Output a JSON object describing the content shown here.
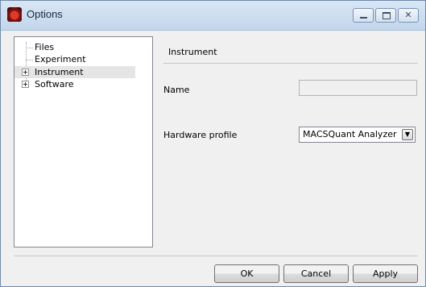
{
  "window": {
    "title": "Options"
  },
  "tree": {
    "items": [
      {
        "label": "Files",
        "expandable": false
      },
      {
        "label": "Experiment",
        "expandable": false
      },
      {
        "label": "Instrument",
        "expandable": true,
        "selected": true
      },
      {
        "label": "Software",
        "expandable": true
      }
    ]
  },
  "panel": {
    "section_title": "Instrument",
    "name_label": "Name",
    "name_value": "",
    "hardware_label": "Hardware profile",
    "hardware_value": "MACSQuant Analyzer"
  },
  "buttons": {
    "ok": "OK",
    "cancel": "Cancel",
    "apply": "Apply"
  },
  "icons": {
    "app": "app-logo-icon",
    "dropdown": "chevron-down-icon"
  }
}
